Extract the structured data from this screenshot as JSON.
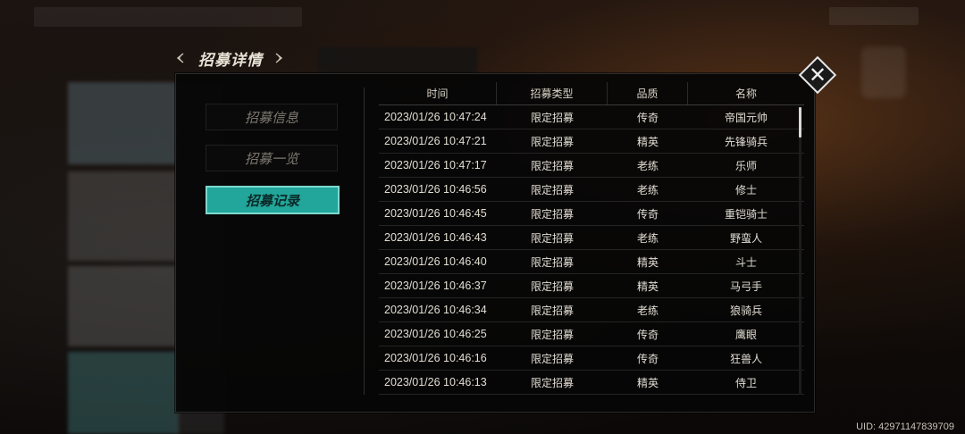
{
  "header": {
    "title": "招募详情"
  },
  "menu": [
    {
      "label": "招募信息",
      "active": false
    },
    {
      "label": "招募一览",
      "active": false
    },
    {
      "label": "招募记录",
      "active": true
    }
  ],
  "table": {
    "headers": [
      "时间",
      "招募类型",
      "品质",
      "名称"
    ],
    "rows": [
      [
        "2023/01/26  10:47:24",
        "限定招募",
        "传奇",
        "帝国元帅"
      ],
      [
        "2023/01/26  10:47:21",
        "限定招募",
        "精英",
        "先锋骑兵"
      ],
      [
        "2023/01/26  10:47:17",
        "限定招募",
        "老练",
        "乐师"
      ],
      [
        "2023/01/26  10:46:56",
        "限定招募",
        "老练",
        "修士"
      ],
      [
        "2023/01/26  10:46:45",
        "限定招募",
        "传奇",
        "重铠骑士"
      ],
      [
        "2023/01/26  10:46:43",
        "限定招募",
        "老练",
        "野蛮人"
      ],
      [
        "2023/01/26  10:46:40",
        "限定招募",
        "精英",
        "斗士"
      ],
      [
        "2023/01/26  10:46:37",
        "限定招募",
        "精英",
        "马弓手"
      ],
      [
        "2023/01/26  10:46:34",
        "限定招募",
        "老练",
        "狼骑兵"
      ],
      [
        "2023/01/26  10:46:25",
        "限定招募",
        "传奇",
        "鹰眼"
      ],
      [
        "2023/01/26  10:46:16",
        "限定招募",
        "传奇",
        "狂兽人"
      ],
      [
        "2023/01/26  10:46:13",
        "限定招募",
        "精英",
        "侍卫"
      ]
    ]
  },
  "footer": {
    "uid": "UID: 42971147839709"
  },
  "icons": {
    "prev": "chevron-left-icon",
    "next": "chevron-right-icon",
    "close": "close-icon"
  },
  "colors": {
    "accent": "#22a59a",
    "accent_border": "#7ed8cf"
  }
}
